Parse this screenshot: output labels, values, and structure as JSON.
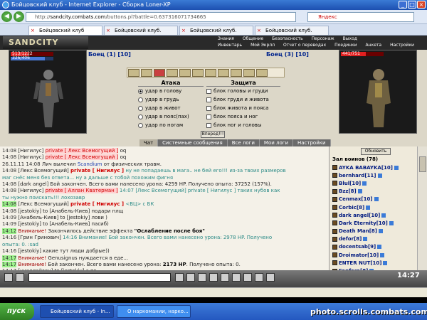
{
  "window": {
    "title": "Бойцовский клуб - Internet Explorer - Сборка Loner-XP"
  },
  "address": {
    "url_host": "sandcity.combats.com",
    "url_path": "/buttons.pl?battle=0.637316071734665",
    "search_placeholder": "Яндекс"
  },
  "browser_tabs": [
    "Бойцовский клуб",
    "Бойцовский клуб.",
    "Бойцовский клуб.",
    "Бойцовский клуб."
  ],
  "game": {
    "logo": "SANDCITY",
    "menu_top": [
      "Знания",
      "Общение",
      "Безопасность",
      "Персонаж",
      "Выход"
    ],
    "menu_bottom": [
      "Инвентарь",
      "Мой Экрлл",
      "Отчет о переводах",
      "Поединки",
      "Анкета",
      "Настройки"
    ],
    "left_fighter": {
      "hp_text": "513/1222",
      "mp_text": "326/406",
      "hp_fraction": 0.42,
      "mp_fraction": 0.8,
      "label": "Боец (1) [10]"
    },
    "right_fighter": {
      "hp_text": "441/751",
      "hp_fraction": 0.59,
      "label": "Боец (3) [10]"
    },
    "attack": {
      "title": "Атака",
      "options": [
        "удар в голову",
        "удар в грудь",
        "удар в живот",
        "удар в пояс(пах)",
        "удар по ногам"
      ],
      "selected": 0
    },
    "defense": {
      "title": "Защита",
      "options": [
        "блок головы и груди",
        "блок груди и живота",
        "блок живота и пояса",
        "блок пояса и ног",
        "блок ног и головы"
      ]
    },
    "go_button": "Вперед!!!",
    "tabs": [
      "Чат",
      "Системные сообщения",
      "Все логи",
      "Мои логи",
      "Настройки"
    ],
    "active_tab": 0
  },
  "chat": [
    {
      "t": "14:08",
      "hl": false,
      "parts": [
        [
          "nick",
          "[Нигилус] "
        ],
        [
          "privbox",
          "private [ Лекс Всемогущий ]"
        ],
        [
          "nick",
          " oq"
        ]
      ]
    },
    {
      "t": "14:08",
      "hl": false,
      "parts": [
        [
          "nick",
          "[Нигилус] "
        ],
        [
          "privbox",
          "private [ Лекс Всемогущий ]"
        ],
        [
          "nick",
          " oq"
        ]
      ]
    },
    {
      "t": "26.11.11 14:08",
      "hl": false,
      "parts": [
        [
          "nick",
          "Лич вылечил "
        ],
        [
          "blue",
          "Scandium"
        ],
        [
          "nick",
          " от физических травм."
        ]
      ]
    },
    {
      "t": "14:08",
      "hl": false,
      "parts": [
        [
          "nick",
          "[Лекс Всемогущий] "
        ],
        [
          "priv",
          "private [ Нигилус ]"
        ],
        [
          "cyan",
          " ну не попадаешь в мага.. не бей его!!! из-за твоих размеров"
        ]
      ]
    },
    {
      "t": "",
      "hl": false,
      "parts": [
        [
          "cyan",
          "маг снёс меня без ответа... ну а дальше с тобой похожим фигня"
        ]
      ]
    },
    {
      "t": "14:08",
      "hl": false,
      "parts": [
        [
          "nick",
          "[dark angel] Бой закончен. Всего вами нанесено урона: 4259 HP. Получено опыта: 37252 (157%)."
        ]
      ]
    },
    {
      "t": "14:08",
      "hl": false,
      "parts": [
        [
          "nick",
          "[Нигилус] "
        ],
        [
          "privbox",
          "private [ Аллан Кватерман ]"
        ],
        [
          "cyan",
          " 14:07 [Лекс Всемогущий] private [ Нигилус ] таких нубов как"
        ]
      ]
    },
    {
      "t": "",
      "hl": false,
      "parts": [
        [
          "cyan",
          "ты нужно поискать!!! лохозавр"
        ]
      ]
    },
    {
      "t": "14:08",
      "hl": true,
      "parts": [
        [
          "nick",
          "[Лекс Всемогущий] "
        ],
        [
          "priv",
          "private [ Нигилус ]"
        ],
        [
          "cyan",
          " <BЦ> с БК"
        ]
      ]
    },
    {
      "t": "14:08",
      "hl": false,
      "parts": [
        [
          "nick",
          "[jestokiy] to [Анабель-Киев] подари плщ"
        ]
      ]
    },
    {
      "t": "14:09",
      "hl": false,
      "parts": [
        [
          "nick",
          "[Анабель-Киев] to [jestokiy] лови )"
        ]
      ]
    },
    {
      "t": "14:09",
      "hl": false,
      "parts": [
        [
          "nick",
          "[jestokiy] to [Анабель-Киев] пасиб)"
        ]
      ]
    },
    {
      "t": "14:12",
      "hl": true,
      "parts": [
        [
          "sys",
          "Внимание! "
        ],
        [
          "nick",
          "Закончилось действие эффекта "
        ],
        [
          "bold",
          "\"Ослабление после боя\""
        ]
      ]
    },
    {
      "t": "14:16",
      "hl": false,
      "parts": [
        [
          "nick",
          "[Грин Гринович] "
        ],
        [
          "cyan",
          "14:16 Внимание! Бой закончен. Всего вами нанесено урона: 2978 HP. Получено"
        ]
      ]
    },
    {
      "t": "",
      "hl": false,
      "parts": [
        [
          "cyan",
          "опыта: 0. :sad"
        ]
      ]
    },
    {
      "t": "14:16",
      "hl": false,
      "parts": [
        [
          "nick",
          "[jestokiy] какие тут люди добрые))"
        ]
      ]
    },
    {
      "t": "14:17",
      "hl": true,
      "parts": [
        [
          "sys",
          "Внимание! "
        ],
        [
          "nick",
          "Genusignus нуждается в еде..."
        ]
      ]
    },
    {
      "t": "14:17",
      "hl": true,
      "parts": [
        [
          "sys",
          "Внимание! "
        ],
        [
          "nick",
          "Бой закончен. Всего вами нанесено урона: "
        ],
        [
          "bold",
          "2173 HP"
        ],
        [
          "nick",
          ". Получено опыта: 0."
        ]
      ]
    },
    {
      "t": "14:17",
      "hl": false,
      "parts": [
        [
          "nick",
          "[николайзен] to [jestokiy] а то .."
        ]
      ]
    },
    {
      "t": "14:17",
      "hl": false,
      "parts": [
        [
          "nick",
          "[jestokiy] to [николайзен] ))"
        ]
      ]
    },
    {
      "t": "14:19",
      "hl": false,
      "parts": [
        [
          "nick",
          "[mister-smitt] to [jestokiy] давай бой?))"
        ]
      ]
    }
  ],
  "right_panel": {
    "refresh": "Обновить",
    "title": "Зал воинов (78)",
    "users": [
      "AYKA BABAYKA[10]",
      "bernhard[11]",
      "Blul[10]",
      "Bzz[8]",
      "Cenmax[10]",
      "Corbic[8]",
      "dark angel[10]",
      "Dark Eternity[10]",
      "Death Man[8]",
      "defor[8]",
      "docentsab[9]",
      "Droimator[10]",
      "ENTER NUT[10]",
      "Fanfara[8]",
      "jestokiy[8]",
      "Kable-ua[9]"
    ]
  },
  "toolbar": {
    "clock": "14:27"
  },
  "taskbar": {
    "start": "пуск",
    "tasks": [
      "Бойцовский клуб - In...",
      "О наркомании, нарко..."
    ]
  },
  "watermark": "photo.scrolls.combats.com"
}
